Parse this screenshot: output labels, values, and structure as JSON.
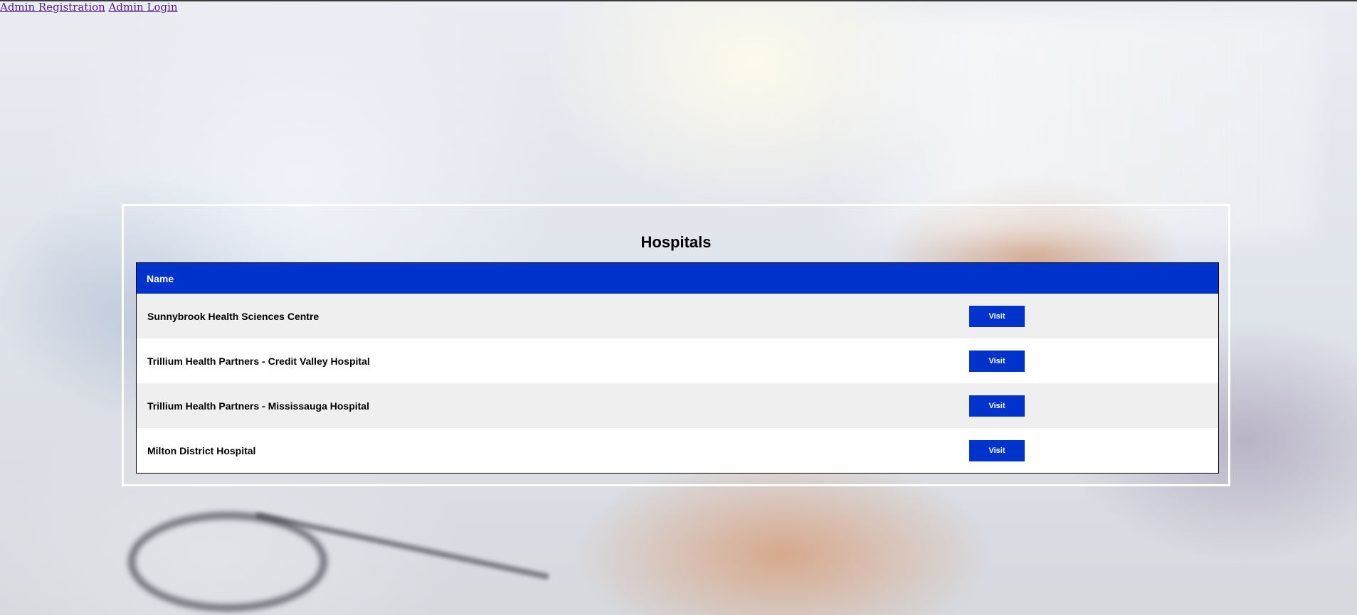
{
  "nav": {
    "admin_registration": "Admin Registration",
    "admin_login": "Admin Login"
  },
  "main": {
    "title": "Hospitals",
    "table": {
      "columns": [
        "Name",
        ""
      ],
      "rows": [
        {
          "name": "Sunnybrook Health Sciences Centre",
          "action": "Visit"
        },
        {
          "name": "Trillium Health Partners - Credit Valley Hospital",
          "action": "Visit"
        },
        {
          "name": "Trillium Health Partners - Mississauga Hospital",
          "action": "Visit"
        },
        {
          "name": "Milton District Hospital",
          "action": "Visit"
        }
      ]
    }
  },
  "colors": {
    "accent": "#0033cc",
    "link": "#551a8b",
    "row_alt": "#efefef",
    "panel_border": "#ffffff"
  }
}
